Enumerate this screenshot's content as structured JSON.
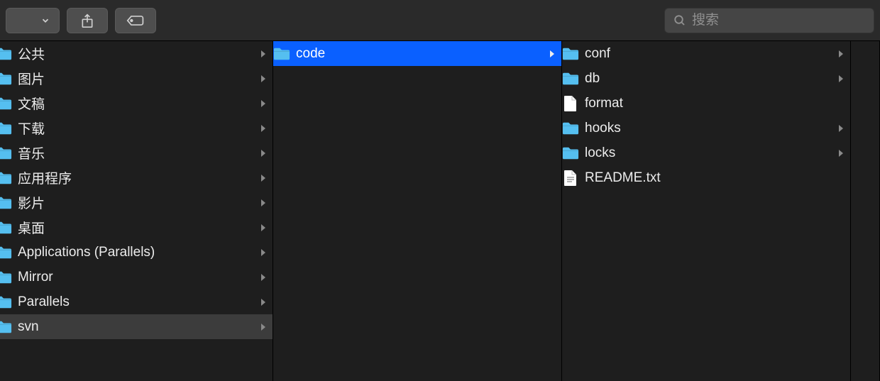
{
  "search": {
    "placeholder": "搜索"
  },
  "columns": [
    {
      "items": [
        {
          "name": "公共",
          "type": "folder",
          "hasChildren": true
        },
        {
          "name": "图片",
          "type": "folder",
          "hasChildren": true
        },
        {
          "name": "文稿",
          "type": "folder",
          "hasChildren": true
        },
        {
          "name": "下载",
          "type": "folder",
          "hasChildren": true
        },
        {
          "name": "音乐",
          "type": "folder",
          "hasChildren": true
        },
        {
          "name": "应用程序",
          "type": "folder",
          "hasChildren": true
        },
        {
          "name": "影片",
          "type": "folder",
          "hasChildren": true
        },
        {
          "name": "桌面",
          "type": "folder",
          "hasChildren": true
        },
        {
          "name": "Applications (Parallels)",
          "type": "folder",
          "hasChildren": true
        },
        {
          "name": "Mirror",
          "type": "folder",
          "hasChildren": true
        },
        {
          "name": "Parallels",
          "type": "folder",
          "hasChildren": true
        },
        {
          "name": "svn",
          "type": "folder",
          "hasChildren": true,
          "state": "open"
        }
      ]
    },
    {
      "items": [
        {
          "name": "code",
          "type": "folder",
          "hasChildren": true,
          "state": "selected"
        }
      ]
    },
    {
      "items": [
        {
          "name": "conf",
          "type": "folder",
          "hasChildren": true
        },
        {
          "name": "db",
          "type": "folder",
          "hasChildren": true
        },
        {
          "name": "format",
          "type": "file",
          "hasChildren": false
        },
        {
          "name": "hooks",
          "type": "folder",
          "hasChildren": true
        },
        {
          "name": "locks",
          "type": "folder",
          "hasChildren": true
        },
        {
          "name": "README.txt",
          "type": "textfile",
          "hasChildren": false
        }
      ]
    },
    {
      "items": []
    }
  ]
}
